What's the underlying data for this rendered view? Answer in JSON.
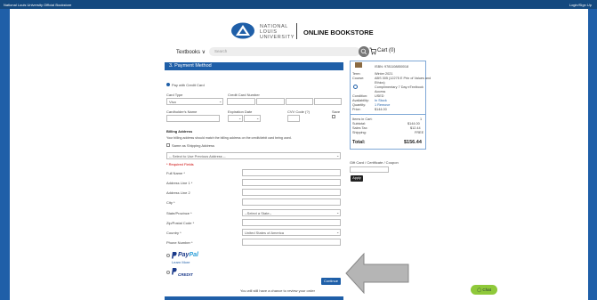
{
  "topbar": {
    "left": "National Louis University Official Bookstore",
    "right": "Login/Sign Up"
  },
  "header": {
    "logo_line1": "NATIONAL",
    "logo_line2": "LOUIS",
    "logo_line3": "UNIVERSITY",
    "store_name": "ONLINE BOOKSTORE"
  },
  "nav": {
    "textbooks": "Textbooks ∨",
    "search_placeholder": "Search",
    "cart": "Cart (0)"
  },
  "payment": {
    "section_title": "3. Payment Method",
    "pay_credit": "Pay with Credit Card",
    "card_type_label": "Card Type",
    "card_type_value": "Visa",
    "card_number_label": "Credit Card Number",
    "cardholder_label": "Cardholder's Name",
    "expiration_label": "Expiration Date",
    "cvv_label": "CVV Code (?)",
    "save_label": "Save",
    "billing_title": "Billing Address",
    "billing_note": "Your billing address should match the billing address on the credit/debit card being used.",
    "same_as_shipping": "Same as Shipping Address",
    "prev_address": "-- Select to Use Previous Address --",
    "required": "* Required Fields",
    "full_name": "Full Name *",
    "address1": "Address Line 1 *",
    "address2": "Address Line 2",
    "city": "City *",
    "state_label": "State/Province *",
    "state_value": "--Select a State--",
    "zip": "Zip/Postal Code *",
    "country_label": "Country *",
    "country_value": "United States of America",
    "phone": "Phone Number *",
    "paypal_pay": "Pay",
    "paypal_pal": "Pal",
    "paypal_learn": "Learn More",
    "paypal_credit": "CREDIT",
    "continue": "Continue",
    "review_note": "You will still have a chance to review your order"
  },
  "summary": {
    "isbn": "ISBN: 9781108850018",
    "term_label": "Term:",
    "term_value": "Winter 2021",
    "course_label": "Course:",
    "course_value_1": "ABS 305 (12275 E Prin of Values and",
    "course_value_2": "Ethics)",
    "course_value_3": "Complimentary 7 Day eTextbook",
    "course_value_4": "Access",
    "condition_label": "Condition:",
    "condition_value": "USED",
    "availability_label": "Availability:",
    "availability_value": "In Stock",
    "quantity_label": "Quantity:",
    "quantity_value": "1 Remove",
    "price_label": "Price:",
    "price_value": "$144.00",
    "items_in_cart": "Items in Cart:",
    "items_count": "1",
    "subtotal_label": "Subtotal:",
    "subtotal_value": "$144.00",
    "tax_label": "Sales Tax:",
    "tax_value": "$12.44",
    "shipping_label": "Shipping:",
    "shipping_value": "FREE",
    "total_label": "Total:",
    "total_value": "$156.44",
    "gift_label": "Gift Card / Certificate / Coupon",
    "apply": "Apply"
  },
  "chat": {
    "label": "Chat"
  },
  "colors": {
    "brand_blue": "#1f5fa8",
    "chat_green": "#8fc93a"
  }
}
